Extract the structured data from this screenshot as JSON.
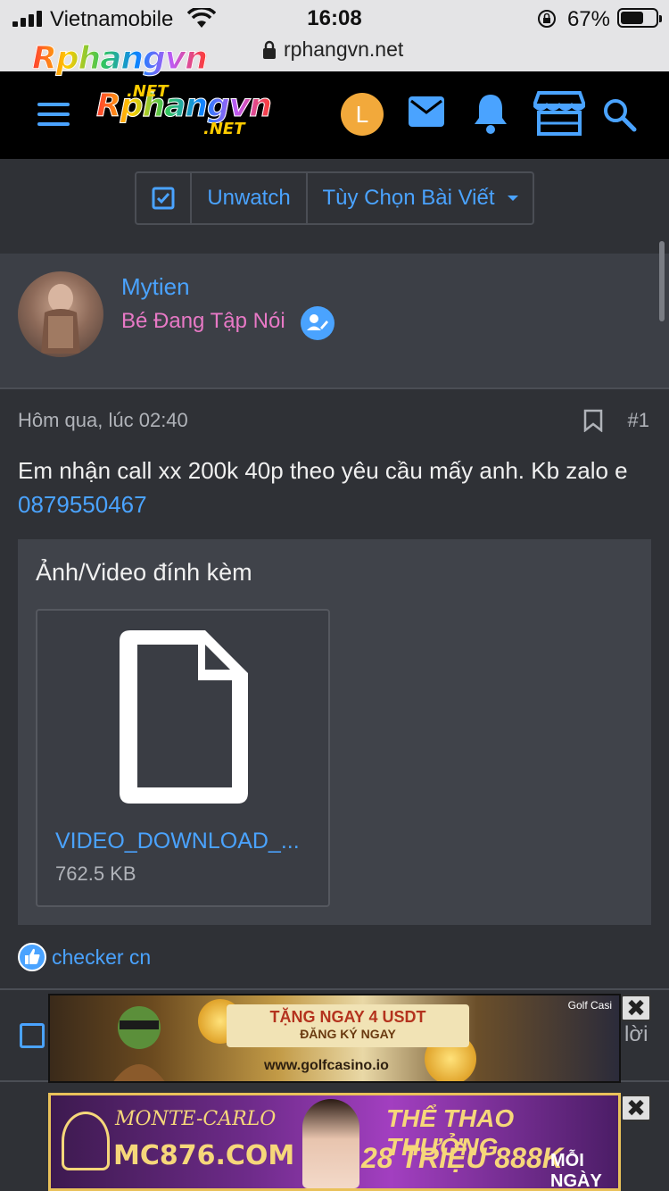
{
  "status_bar": {
    "carrier": "Vietnamobile",
    "time": "16:08",
    "battery_percent": "67%",
    "battery_level": 0.67
  },
  "browser": {
    "url": "rphangvn.net"
  },
  "header": {
    "logo_text": "Rphangvn",
    "logo_sub": ".NET",
    "avatar_letter": "L",
    "icons": [
      "menu-icon",
      "mail-icon",
      "bell-icon",
      "store-icon",
      "search-icon"
    ],
    "accent": "#4aa3ff"
  },
  "toolbar": {
    "unwatch_label": "Unwatch",
    "options_label": "Tùy Chọn Bài Viết"
  },
  "post": {
    "username": "Mytien",
    "user_title": "Bé Đang Tập Nói",
    "timestamp": "Hôm qua, lúc 02:40",
    "post_number": "#1",
    "message_text": "Em nhận call xx 200k 40p theo yêu cầu mấy anh. Kb zalo e ",
    "phone": "0879550467",
    "attachments_title": "Ảnh/Video đính kèm",
    "attachment": {
      "name": "VIDEO_DOWNLOAD_...",
      "size": "762.5 KB"
    },
    "reaction_user": "checker cn",
    "reply_tail": "lời"
  },
  "ads": {
    "ad1": {
      "headline": "TẶNG NGAY 4 USDT",
      "subline": "ĐĂNG KÝ NGAY",
      "site": "www.golfcasino.io",
      "brand": "Golf Casi"
    },
    "ad2": {
      "brand": "MONTE-CARLO",
      "domain": "MC876.COM",
      "headline": "THỂ THAO THƯỞNG",
      "amount": "28 TRIỆU 888K",
      "period": "MỖI NGÀY"
    },
    "close_glyph": "✖"
  }
}
